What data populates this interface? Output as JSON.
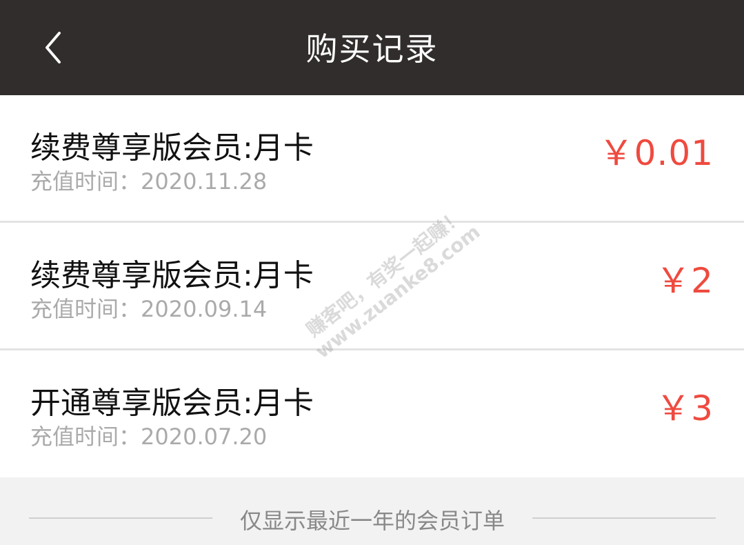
{
  "header": {
    "title": "购买记录",
    "back_icon": "chevron-left-icon"
  },
  "records": [
    {
      "name": "续费尊享版会员:月卡",
      "time": "充值时间：2020.11.28",
      "price": "￥0.01"
    },
    {
      "name": "续费尊享版会员:月卡",
      "time": "充值时间：2020.09.14",
      "price": "￥2"
    },
    {
      "name": "开通尊享版会员:月卡",
      "time": "充值时间：2020.07.20",
      "price": "￥3"
    }
  ],
  "footer": {
    "note": "仅显示最近一年的会员订单"
  },
  "watermark": {
    "line1": "赚客吧，有奖一起赚！",
    "line2": "www.zuanke8.com"
  },
  "colors": {
    "header_bg": "#312d2c",
    "price": "#ef4a3f"
  }
}
